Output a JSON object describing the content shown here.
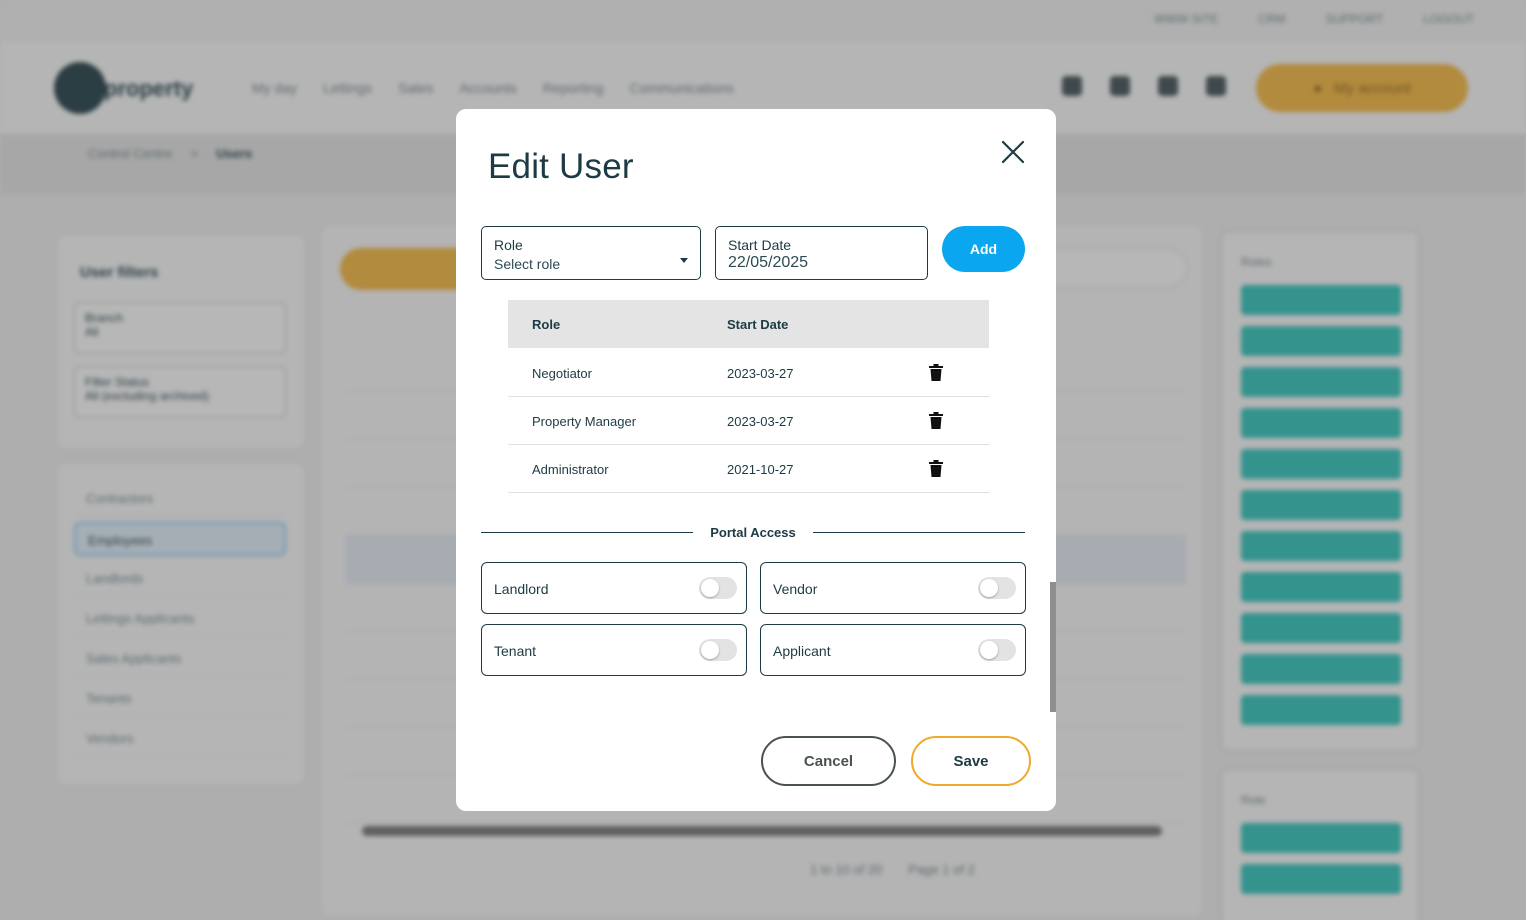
{
  "background": {
    "top_links": [
      "WWW SITE",
      "CRM",
      "SUPPORT",
      "LOGOUT"
    ],
    "logo_text": "property",
    "nav": [
      "My day",
      "Lettings",
      "Sales",
      "Accounts",
      "Reporting",
      "Communications"
    ],
    "account_label": "My account",
    "breadcrumb": [
      "Control Centre",
      "Users"
    ],
    "filters_title": "User filters",
    "filter_fields": [
      {
        "label": "Branch",
        "value": "All"
      },
      {
        "label": "Filter Status",
        "value": "All (excluding archived)"
      }
    ],
    "user_types": [
      "Contractors",
      "Employees",
      "Landlords",
      "Lettings Applicants",
      "Sales Applicants",
      "Tenants",
      "Vendors"
    ],
    "selected_user_type": "Employees",
    "pager_text": "1 to 10 of 20",
    "pager_page": "Page 1 of 2",
    "roles_title": "Roles",
    "roles_title2": "Role"
  },
  "modal": {
    "title": "Edit User",
    "role_field": {
      "label": "Role",
      "placeholder": "Select role"
    },
    "start_date_field": {
      "label": "Start Date",
      "value": "22/05/2025"
    },
    "add_label": "Add",
    "table": {
      "headers": {
        "role": "Role",
        "start_date": "Start Date"
      },
      "rows": [
        {
          "role": "Negotiator",
          "start_date": "2023-03-27"
        },
        {
          "role": "Property Manager",
          "start_date": "2023-03-27"
        },
        {
          "role": "Administrator",
          "start_date": "2021-10-27"
        }
      ]
    },
    "portal_access_label": "Portal Access",
    "portal_access": {
      "landlord": {
        "label": "Landlord",
        "enabled": false
      },
      "vendor": {
        "label": "Vendor",
        "enabled": false
      },
      "tenant": {
        "label": "Tenant",
        "enabled": false
      },
      "applicant": {
        "label": "Applicant",
        "enabled": false
      }
    },
    "cancel_label": "Cancel",
    "save_label": "Save"
  },
  "colors": {
    "primary_text": "#1d3b44",
    "add_button": "#0aa7f0",
    "save_border": "#f0a92a",
    "accent_yellow": "#f0b23a",
    "chip_teal": "#2bbfb6"
  }
}
